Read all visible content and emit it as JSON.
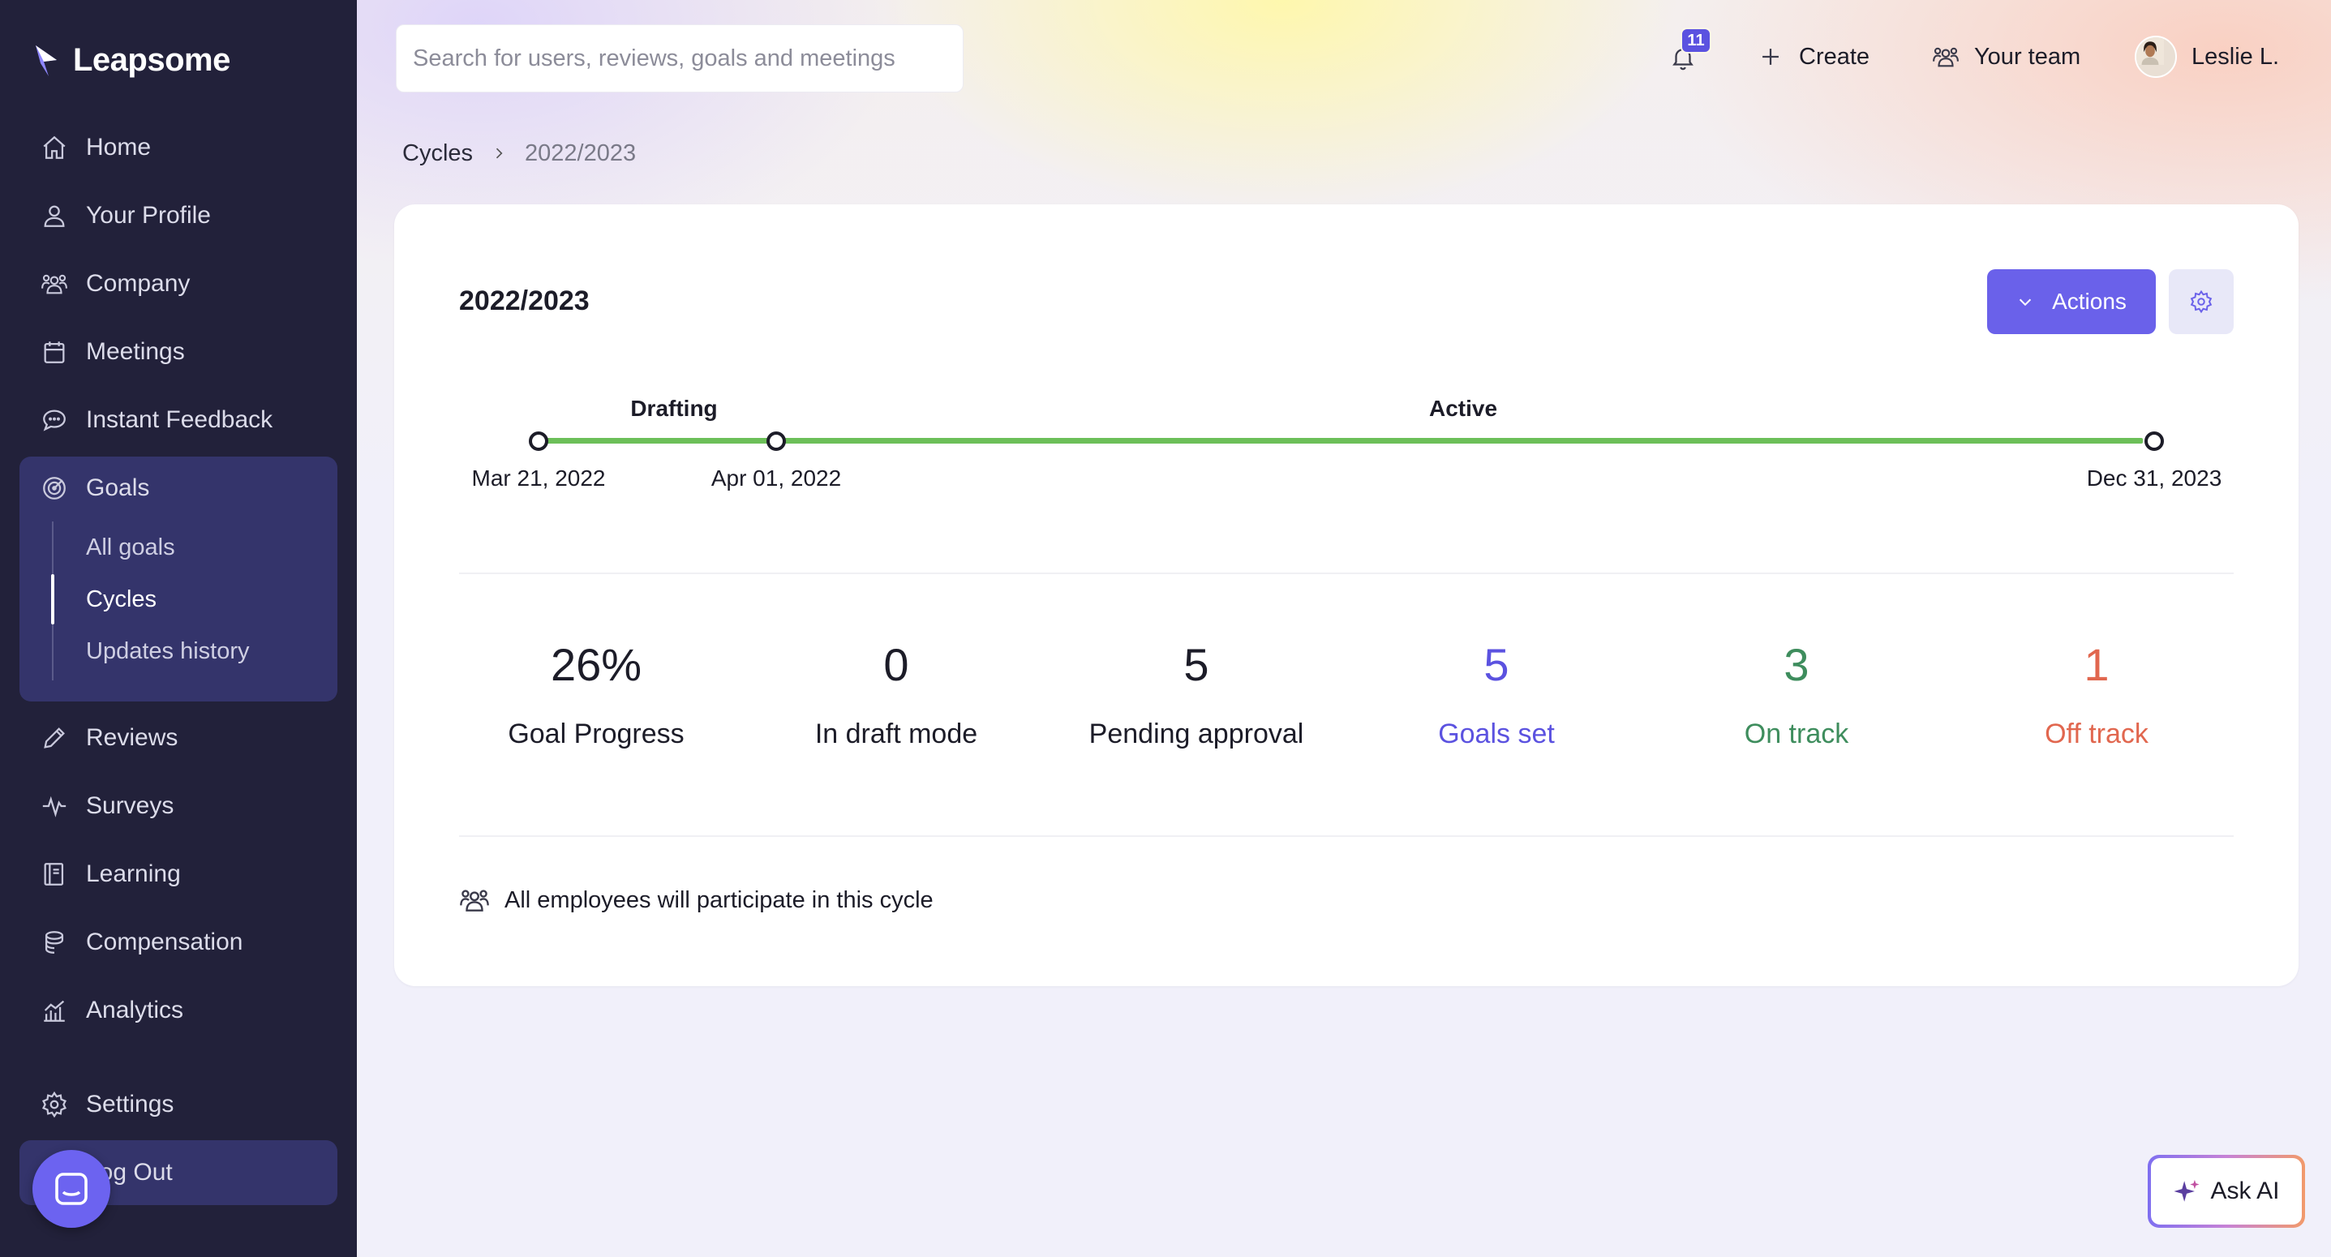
{
  "app": {
    "name": "Leapsome"
  },
  "sidebar": {
    "items": [
      {
        "label": "Home",
        "icon": "home-icon"
      },
      {
        "label": "Your Profile",
        "icon": "user-icon"
      },
      {
        "label": "Company",
        "icon": "people-icon"
      },
      {
        "label": "Meetings",
        "icon": "calendar-icon"
      },
      {
        "label": "Instant Feedback",
        "icon": "chat-icon"
      },
      {
        "label": "Goals",
        "icon": "target-icon"
      },
      {
        "label": "Reviews",
        "icon": "pencil-icon"
      },
      {
        "label": "Surveys",
        "icon": "pulse-icon"
      },
      {
        "label": "Learning",
        "icon": "book-icon"
      },
      {
        "label": "Compensation",
        "icon": "coins-icon"
      },
      {
        "label": "Analytics",
        "icon": "chart-icon"
      },
      {
        "label": "Settings",
        "icon": "gear-icon"
      },
      {
        "label": "Log Out",
        "icon": "logout-icon"
      }
    ],
    "goals_sub": [
      "All goals",
      "Cycles",
      "Updates history"
    ],
    "active_sub": "Cycles"
  },
  "header": {
    "search_placeholder": "Search for users, reviews, goals and meetings",
    "notifications_count": "11",
    "create_label": "Create",
    "team_label": "Your team",
    "user_name": "Leslie L."
  },
  "breadcrumb": {
    "parent": "Cycles",
    "current": "2022/2023"
  },
  "cycle": {
    "title": "2022/2023",
    "actions_label": "Actions",
    "timeline": {
      "phases": [
        "Drafting",
        "Active"
      ],
      "dates": [
        "Mar 21, 2022",
        "Apr 01, 2022",
        "Dec 31, 2023"
      ]
    },
    "stats": [
      {
        "value": "26%",
        "label": "Goal Progress",
        "tone": "default"
      },
      {
        "value": "0",
        "label": "In draft mode",
        "tone": "default"
      },
      {
        "value": "5",
        "label": "Pending approval",
        "tone": "default"
      },
      {
        "value": "5",
        "label": "Goals set",
        "tone": "blue"
      },
      {
        "value": "3",
        "label": "On track",
        "tone": "green"
      },
      {
        "value": "1",
        "label": "Off track",
        "tone": "red"
      }
    ],
    "participants_text": "All employees will participate in this cycle"
  },
  "ask_ai": {
    "label": "Ask AI"
  },
  "colors": {
    "sidebar_bg": "#22213a",
    "accent": "#6a61ea",
    "timeline_green": "#6cbf59",
    "on_track": "#3e8d5d",
    "off_track": "#e1674f",
    "goals_set": "#5b52e0"
  }
}
